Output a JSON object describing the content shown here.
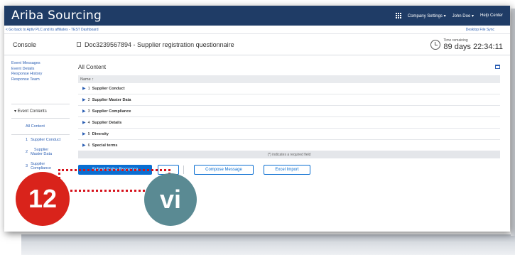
{
  "app": {
    "brand": "Ariba Sourcing"
  },
  "topnav": {
    "company_settings": "Company Settings ▾",
    "user": "John Doe ▾",
    "help": "Help Center"
  },
  "subbar": {
    "back_link": "< Go back to Aptiv PLC and its affiliates - TEST Dashboard",
    "desktop_sync": "Desktop File Sync"
  },
  "header": {
    "console": "Console",
    "doc_title": "Doc3239567894 - Supplier registration questionnaire",
    "time_label": "Time remaining",
    "time_value": "89 days 22:34:11"
  },
  "sidebar": {
    "links": [
      "Event Messages",
      "Event Details",
      "Response History",
      "Response Team"
    ],
    "event_contents": "▾  Event Contents",
    "all_content": "All Content",
    "items": [
      {
        "num": "1",
        "label": "Supplier Conduct"
      },
      {
        "num": "2",
        "label": "Supplier Master Data"
      },
      {
        "num": "3",
        "label": "Supplier Compliance"
      }
    ]
  },
  "main": {
    "title": "All Content",
    "column_name": "Name ↑",
    "rows": [
      {
        "num": "1",
        "name": "Supplier Conduct"
      },
      {
        "num": "2",
        "name": "Supplier Master Data"
      },
      {
        "num": "3",
        "name": "Supplier Compliance"
      },
      {
        "num": "4",
        "name": "Supplier Details"
      },
      {
        "num": "5",
        "name": "Diversity"
      },
      {
        "num": "6",
        "name": "Special terms"
      }
    ],
    "required_note": "(*) indicates a required field"
  },
  "buttons": {
    "submit": "Submit Entire Response",
    "compose": "Compose Message",
    "excel": "Excel Import"
  },
  "annotations": {
    "step_number": "12",
    "roman": "vi"
  },
  "colors": {
    "header_bg": "#1f3c66",
    "primary": "#0a6ed1",
    "callout_red": "#d9231b",
    "callout_teal": "#5a8a93"
  }
}
